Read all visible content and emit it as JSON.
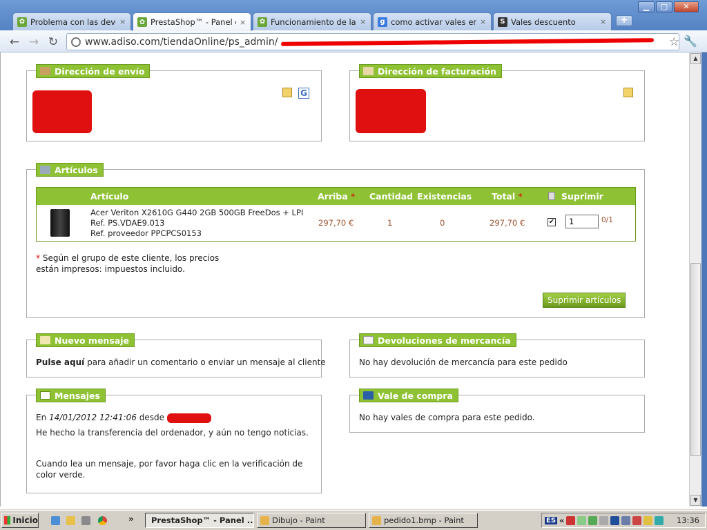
{
  "browser": {
    "tabs": [
      {
        "title": "Problema con las devolucic",
        "favicon": "prestashop-icon"
      },
      {
        "title": "PrestaShop™ - Panel de a",
        "favicon": "prestashop-icon",
        "active": true
      },
      {
        "title": "Funcionamiento de la búsq",
        "favicon": "prestashop-icon"
      },
      {
        "title": "como activar vales en pres",
        "favicon": "google-icon"
      },
      {
        "title": "Vales descuento",
        "favicon": "s-icon"
      }
    ],
    "tab_close_glyph": "×",
    "new_tab_glyph": "+",
    "url": "www.adiso.com/tiendaOnline/ps_admin/"
  },
  "shipping": {
    "title": "Dirección de envío"
  },
  "billing": {
    "title": "Dirección de facturación"
  },
  "articles": {
    "title": "Artículos",
    "headers": {
      "article": "Artículo",
      "price": "Arriba",
      "qty": "Cantidad",
      "stock": "Existencias",
      "total": "Total",
      "delete": "Suprimir"
    },
    "required_mark": "*",
    "item": {
      "name": "Acer Veriton X2610G G440 2GB 500GB FreeDos + LPI",
      "ref": "Ref. PS.VDAE9.013",
      "supplier_ref": "Ref. proveedor PPCPCS0153",
      "price": "297,70 €",
      "qty": "1",
      "stock": "0",
      "total": "297,70 €",
      "delete_qty": "1",
      "returned": "0/1"
    },
    "note_line1": "Según el grupo de este cliente, los precios",
    "note_line2": "están impresos: impuestos incluido.",
    "delete_button": "Suprimir artículos"
  },
  "new_message": {
    "title": "Nuevo mensaje",
    "link": "Pulse aquí",
    "text": " para añadir un comentario o enviar un mensaje al cliente"
  },
  "returns": {
    "title": "Devoluciones de mercancía",
    "text": "No hay devolución de mercancía para este pedido"
  },
  "messages": {
    "title": "Mensajes",
    "prefix": "En ",
    "date": "14/01/2012 12:41:06",
    "from": " desde ",
    "body": "He hecho la transferencia del ordenador, y aún no tengo noticias.",
    "hint": "Cuando lea un mensaje, por favor haga clic en la verificación de color verde."
  },
  "voucher": {
    "title": "Vale de compra",
    "text": "No hay vales de compra para este pedido."
  },
  "taskbar": {
    "start": "Inicio",
    "chevron": "»",
    "tasks": [
      "PrestaShop™ - Panel ...",
      "Dibujo - Paint",
      "pedido1.bmp - Paint"
    ],
    "lang": "ES",
    "tray_chevron": "«",
    "clock": "13:36"
  }
}
